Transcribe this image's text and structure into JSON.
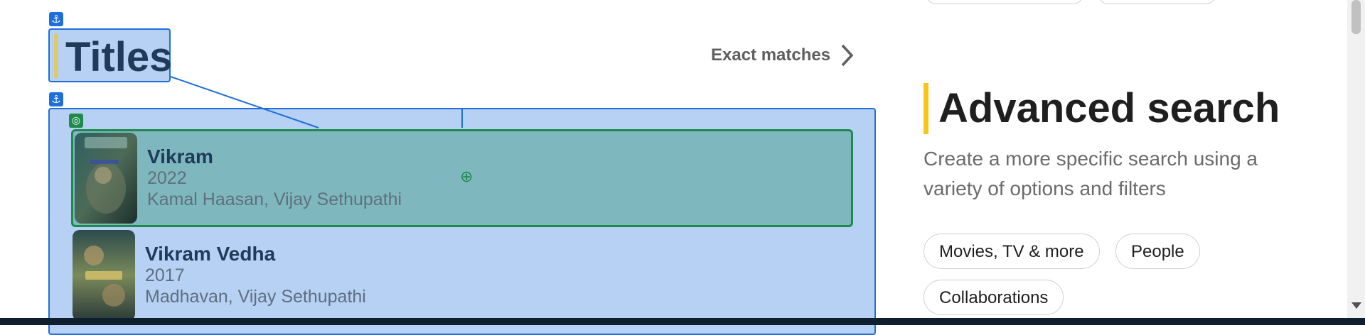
{
  "titles_section": {
    "heading": "Titles",
    "exact_matches_label": "Exact matches"
  },
  "results": [
    {
      "title": "Vikram",
      "year": "2022",
      "cast": "Kamal Haasan, Vijay Sethupathi",
      "selected": true
    },
    {
      "title": "Vikram Vedha",
      "year": "2017",
      "cast": "Madhavan, Vijay Sethupathi",
      "selected": false
    }
  ],
  "advanced_search": {
    "title": "Advanced search",
    "description": "Create a more specific search using a variety of options and filters",
    "chips": [
      "Movies, TV & more",
      "People",
      "Collaborations"
    ]
  },
  "overlay": {
    "anchor_glyph": "⚓",
    "target_glyph": "◎",
    "crosshair_glyph": "⊕"
  },
  "colors": {
    "accent_yellow": "#f5c518",
    "overlay_blue": "#1e6fd9",
    "overlay_green": "#1f8a4c",
    "selected_fill": "#7eb8be"
  }
}
